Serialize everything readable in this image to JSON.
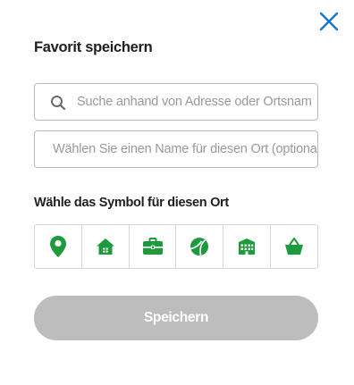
{
  "dialog": {
    "title": "Favorit speichern",
    "close_icon": "close-icon"
  },
  "search": {
    "icon": "search-icon",
    "placeholder": "Suche anhand von Adresse oder Ortsname",
    "value": ""
  },
  "name_field": {
    "placeholder": "Wählen Sie einen Name für diesen Ort (optional)",
    "value": ""
  },
  "symbol_picker": {
    "label": "Wähle das Symbol für diesen Ort",
    "icons": [
      "location-pin-icon",
      "home-icon",
      "briefcase-icon",
      "ball-icon",
      "building-icon",
      "shopping-basket-icon"
    ]
  },
  "save_button": {
    "label": "Speichern"
  },
  "colors": {
    "accent": "#1a75cf",
    "icon_green": "#1d9a3b",
    "button_disabled": "#bdbdbd",
    "border": "#b8b8b8",
    "text": "#1f1f1f",
    "placeholder": "#9a9a9a"
  }
}
